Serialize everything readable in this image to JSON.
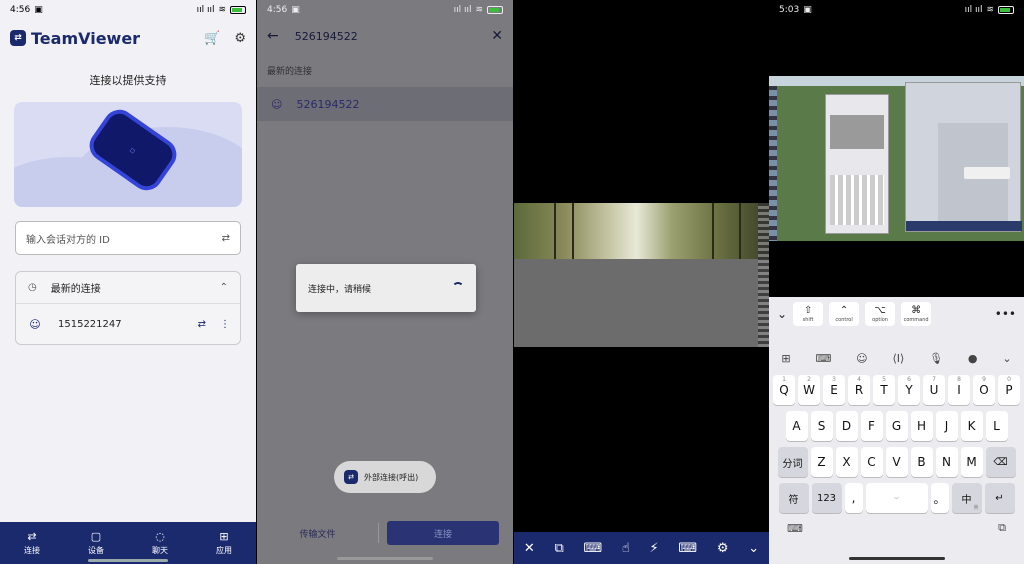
{
  "panel1": {
    "time": "4:56",
    "signal": "∗ ⁙⁙ ᯤ",
    "brand": "TeamViewer",
    "logo_mark": "⇄",
    "icons": [
      "cart-icon",
      "gear-icon"
    ],
    "heading": "连接以提供支持",
    "id_placeholder": "输入会话对方的 ID",
    "recent_title": "最新的连接",
    "recent_items": [
      {
        "id": "1515221247"
      }
    ],
    "tabs": [
      {
        "label": "连接",
        "icon": "⇄"
      },
      {
        "label": "设备",
        "icon": "▢"
      },
      {
        "label": "聊天",
        "icon": "◌"
      },
      {
        "label": "应用",
        "icon": "⊞"
      }
    ]
  },
  "panel2": {
    "time": "4:56",
    "search_value": "526194522",
    "section_label": "最新的连接",
    "recent_items": [
      {
        "id": "526194522"
      }
    ],
    "dialog_text": "连接中，请稍候",
    "toast_text": "外部连接(呼出)",
    "files_label": "传输文件",
    "connect_label": "连接"
  },
  "panel3": {
    "toolbar_icons": [
      "close-icon",
      "display-icon",
      "keyboard-icon",
      "touch-icon",
      "flash-icon",
      "keyboard-settings-icon",
      "gear-icon",
      "chevron-down-icon"
    ],
    "toolbar_glyphs": [
      "✕",
      "⧉",
      "⌨",
      "☝",
      "⚡",
      "⌨",
      "⚙",
      "⌄"
    ]
  },
  "panel4": {
    "time": "5:03",
    "modifiers": [
      {
        "symbol": "⇧",
        "label": "shift"
      },
      {
        "symbol": "⌃",
        "label": "control"
      },
      {
        "symbol": "⌥",
        "label": "option"
      },
      {
        "symbol": "⌘",
        "label": "command"
      }
    ],
    "keys_row1": [
      "Q",
      "W",
      "E",
      "R",
      "T",
      "Y",
      "U",
      "I",
      "O",
      "P"
    ],
    "keys_row1_nums": [
      "1",
      "2",
      "3",
      "4",
      "5",
      "6",
      "7",
      "8",
      "9",
      "0"
    ],
    "keys_row2": [
      "A",
      "S",
      "D",
      "F",
      "G",
      "H",
      "J",
      "K",
      "L"
    ],
    "keys_row3": [
      "Z",
      "X",
      "C",
      "V",
      "B",
      "N",
      "M"
    ],
    "key_split": "分词",
    "key_symbol": "符",
    "key_123": "123",
    "key_comma": ",",
    "key_period": "。",
    "key_lang": "中",
    "key_lang_sub": "英"
  }
}
